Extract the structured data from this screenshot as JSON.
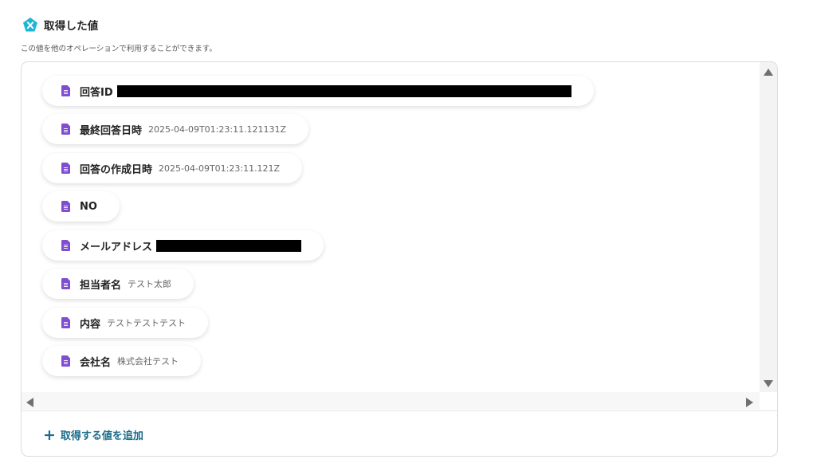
{
  "header": {
    "title": "取得した値",
    "subtitle": "この値を他のオペレーションで利用することができます。",
    "icon": "pentagon-x-icon",
    "icon_color": "#1fb6d6"
  },
  "items": [
    {
      "label": "回答ID",
      "value": "",
      "redacted": true
    },
    {
      "label": "最終回答日時",
      "value": "2025-04-09T01:23:11.121131Z",
      "redacted": false
    },
    {
      "label": "回答の作成日時",
      "value": "2025-04-09T01:23:11.121Z",
      "redacted": false
    },
    {
      "label": "NO",
      "value": "",
      "redacted": false
    },
    {
      "label": "メールアドレス",
      "value": "",
      "redacted": true
    },
    {
      "label": "担当者名",
      "value": "テスト太郎",
      "redacted": false
    },
    {
      "label": "内容",
      "value": "テストテストテスト",
      "redacted": false
    },
    {
      "label": "会社名",
      "value": "株式会社テスト",
      "redacted": false
    }
  ],
  "item_icon": "google-forms-icon",
  "item_icon_color": "#7f4ed1",
  "add_button": {
    "label": "取得する値を追加",
    "icon": "plus-icon",
    "color": "#1c6d8a"
  }
}
